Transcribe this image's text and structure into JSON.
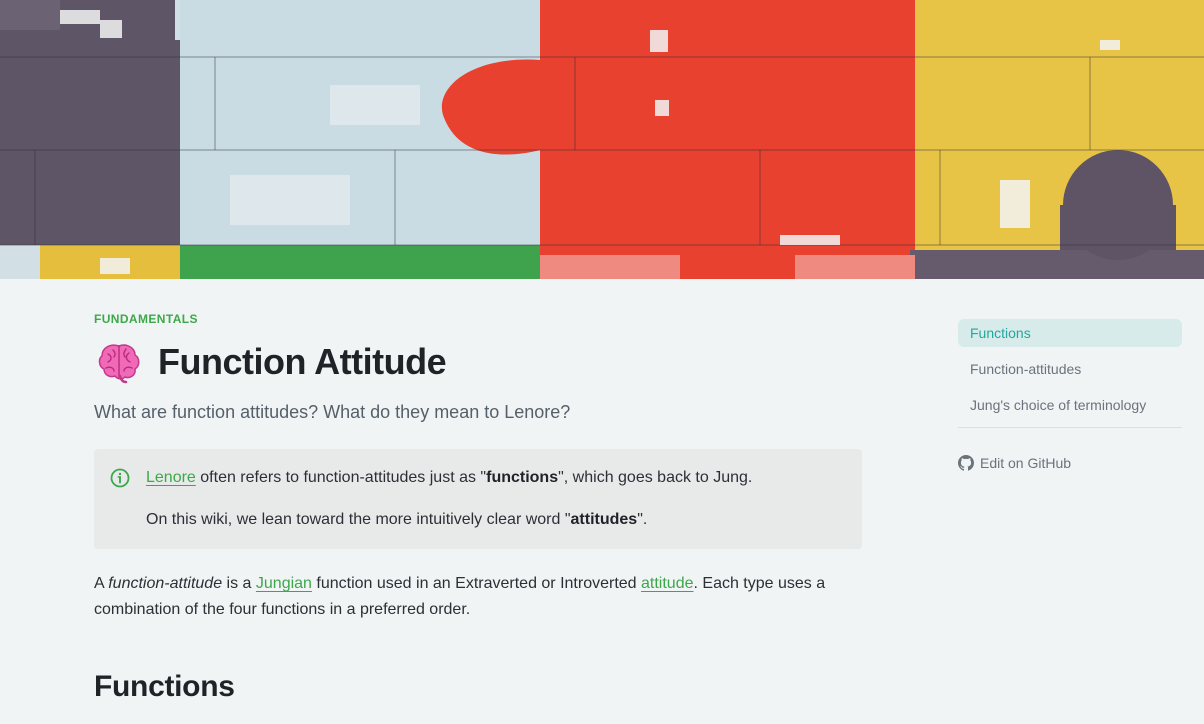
{
  "page": {
    "section_label": "FUNDAMENTALS",
    "title": "Function Attitude",
    "subtitle": "What are function attitudes? What do they mean to Lenore?"
  },
  "callout": {
    "line1": {
      "link": "Lenore",
      "text_a": " often refers to function-attitudes just as \"",
      "bold": "functions",
      "text_b": "\", which goes back to Jung."
    },
    "line2": {
      "text_a": "On this wiki, we lean toward the more intuitively clear word \"",
      "bold": "attitudes",
      "text_b": "\"."
    }
  },
  "body": {
    "a": "A ",
    "em": "function-attitude",
    "b": " is a ",
    "link1": "Jungian",
    "c": " function used in an Extraverted or Introverted ",
    "link2": "attitude",
    "d": ". Each type uses a combination of the four functions in a preferred order."
  },
  "heading_functions": "Functions",
  "toc": {
    "items": [
      "Functions",
      "Function-attitudes",
      "Jung's choice of terminology"
    ],
    "active_index": 0,
    "edit_label": "Edit on GitHub"
  },
  "colors": {
    "accent_green": "#3da84a",
    "toc_active": "#23a6a0",
    "background": "#f1f4f5"
  }
}
